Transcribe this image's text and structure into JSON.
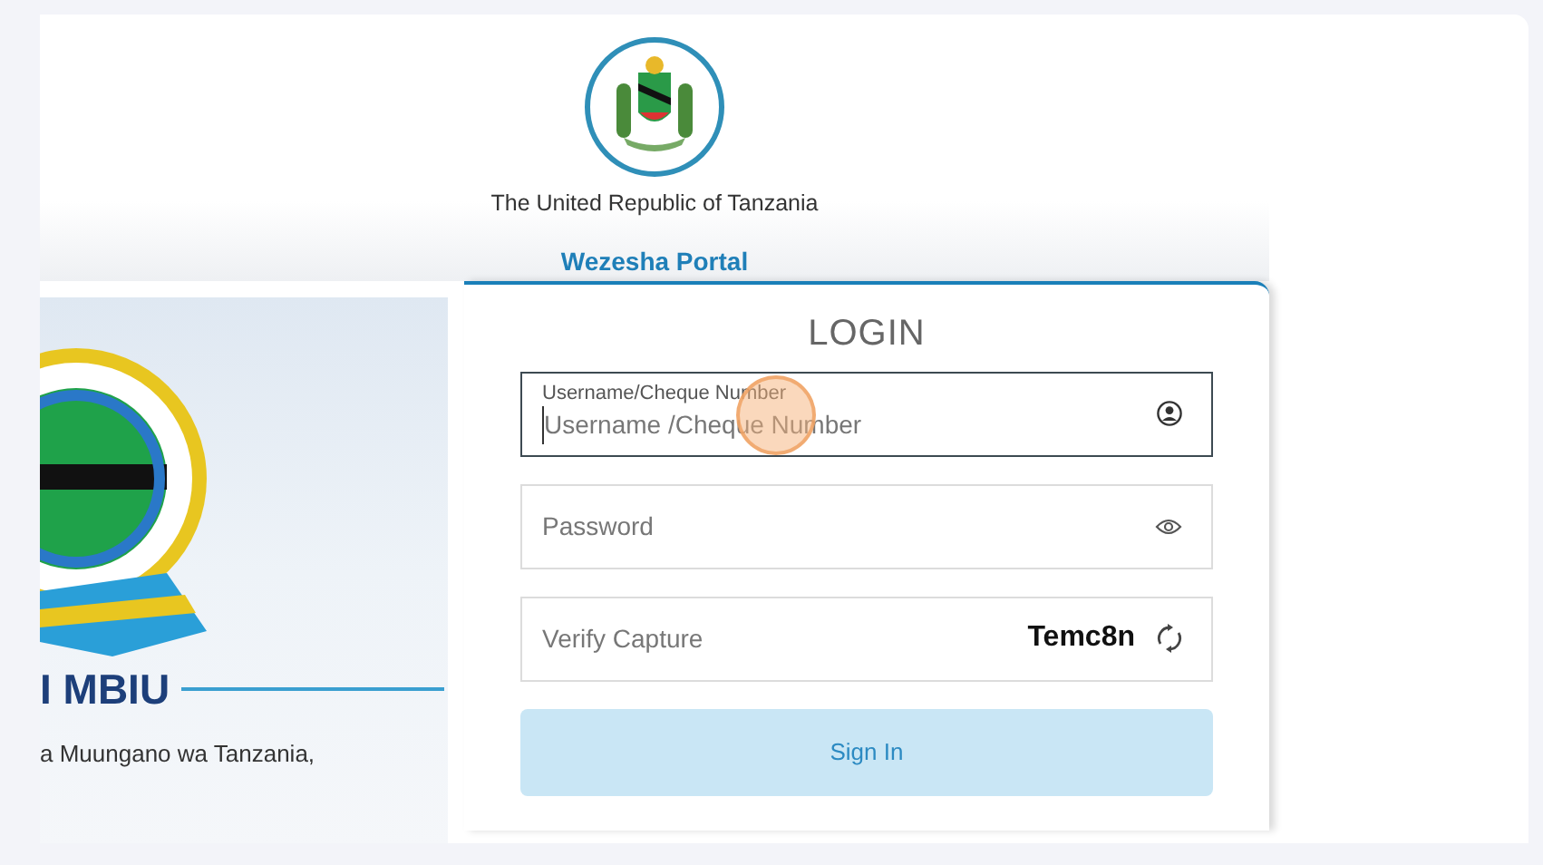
{
  "header": {
    "country": "The United Republic of Tanzania",
    "portal": "Wezesha Portal"
  },
  "banner": {
    "heading": "I MBIU",
    "text": "a Muungano wa Tanzania,"
  },
  "login": {
    "title": "LOGIN",
    "fields": [
      {
        "kind": "username",
        "label": "Username/Cheque Number",
        "placeholder": "Username /Cheque Number",
        "focused": true
      },
      {
        "kind": "password",
        "placeholder": "Password",
        "focused": false
      },
      {
        "kind": "captcha",
        "placeholder": "Verify Capture",
        "code": "Temc8n",
        "focused": false
      }
    ],
    "button": "Sign In"
  }
}
